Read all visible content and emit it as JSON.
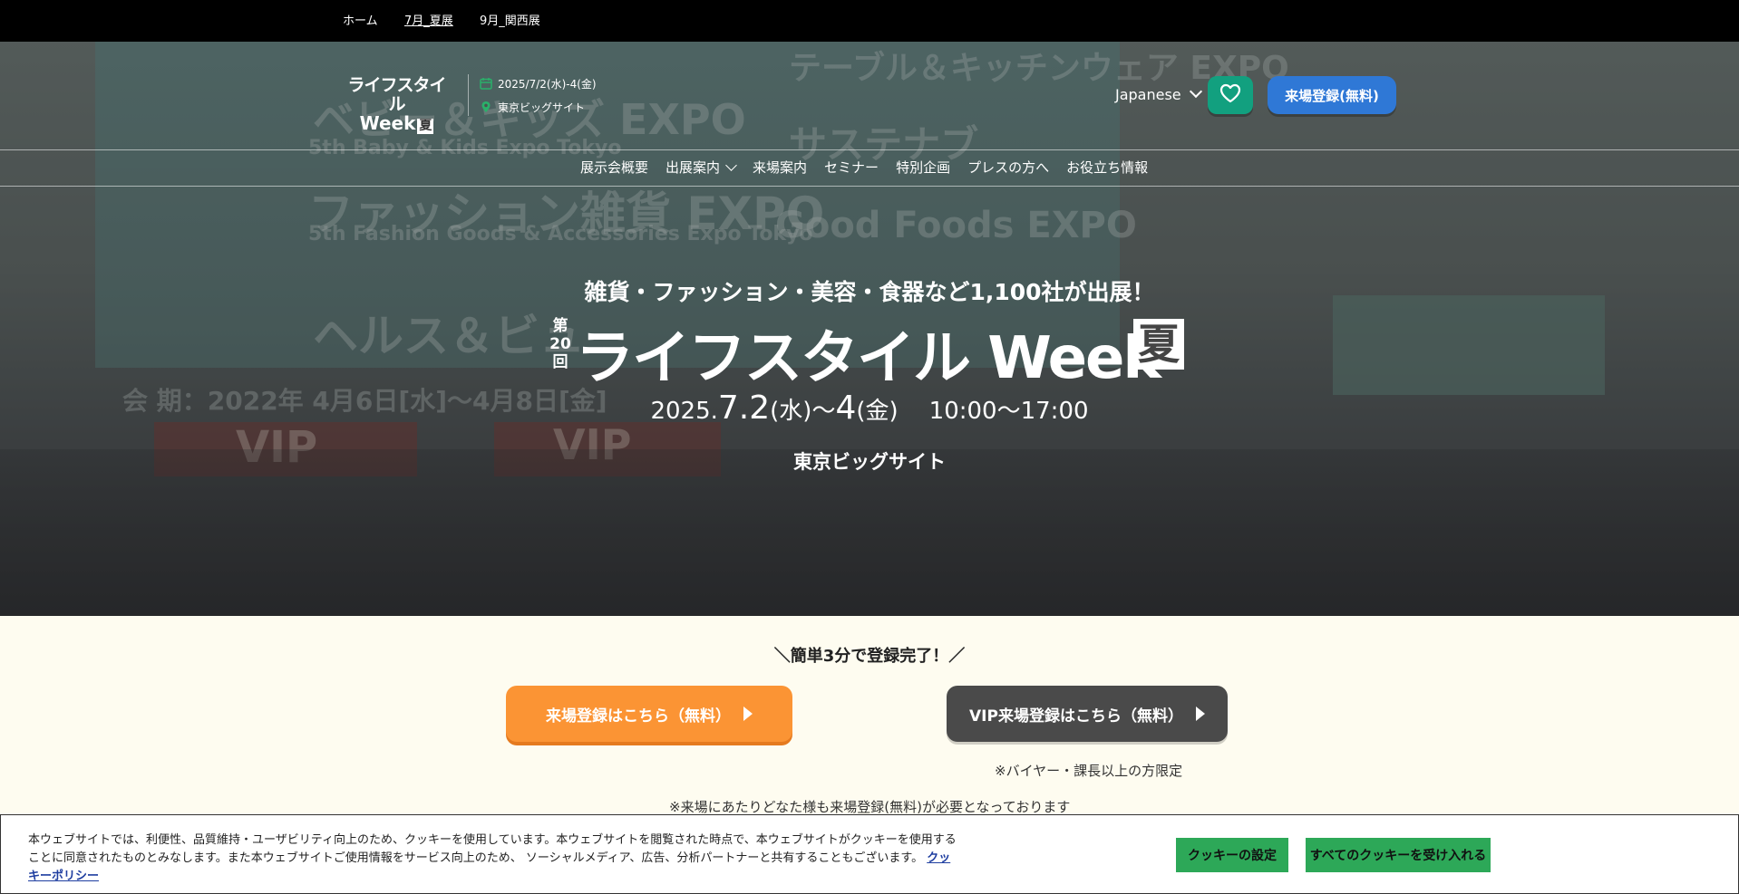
{
  "topnav": {
    "home": "ホーム",
    "summer": "7月_夏展",
    "kansai": "9月_関西展"
  },
  "header": {
    "logo_line1": "ライフスタイル",
    "logo_line2": "Week",
    "logo_badge": "夏",
    "date": "2025/7/2(水)-4(金)",
    "venue": "東京ビッグサイト",
    "language": "Japanese",
    "register_button": "来場登録(無料)",
    "accent_green": "#12a07f",
    "accent_blue": "#2f78d6"
  },
  "nav": {
    "items": [
      "展示会概要",
      "出展案内",
      "来場案内",
      "セミナー",
      "特別企画",
      "プレスの方へ",
      "お役立ち情報"
    ]
  },
  "hero": {
    "tagline": "雑貨・ファッション・美容・食器など1,100社が出展！",
    "edition_1": "第",
    "edition_2": "20",
    "edition_3": "回",
    "title": "ライフスタイル Week",
    "title_badge": "夏",
    "year": "2025.",
    "date_start": "7.2",
    "dow_start": "(水)",
    "tilde": "〜",
    "date_end": "4",
    "dow_end": "(金)",
    "hours": "10:00〜17:00",
    "venue": "東京ビッグサイト",
    "bg_text": {
      "baby": "ベビー＆キッズ EXPO",
      "baby_en": "5th Baby & Kids Expo Tokyo",
      "fashion": "ファッション雑貨 EXPO",
      "fashion_en": "5th Fashion Goods & Accessories Expo Tokyo",
      "health": "ヘルス＆ビュ",
      "table": "テーブル＆キッチンウェア EXPO",
      "sustain": "サステナブ",
      "good_foods": "Good Foods EXPO",
      "period": "会 期：2022年 4月6日[水]〜4月8日[金]",
      "vip": "VIP"
    }
  },
  "registration": {
    "headline": "＼簡単3分で登録完了！／",
    "general_button": "来場登録はこちら（無料）",
    "vip_button": "VIP来場登録はこちら（無料）",
    "vip_note": "※バイヤー・課長以上の方限定",
    "required_note": "※来場にあたりどなた様も来場登録(無料)が必要となっております",
    "orange": "#fb9434"
  },
  "cookie": {
    "text": "本ウェブサイトでは、利便性、品質維持・ユーザビリティ向上のため、クッキーを使用しています。本ウェブサイトを閲覧された時点で、本ウェブサイトがクッキーを使用することに同意されたものとみなします。また本ウェブサイトご使用情報をサービス向上のため、 ソーシャルメディア、広告、分析パートナーと共有することもございます。",
    "policy_link": "クッキーポリシー",
    "settings_button": "クッキーの設定",
    "accept_button": "すべてのクッキーを受け入れる"
  }
}
